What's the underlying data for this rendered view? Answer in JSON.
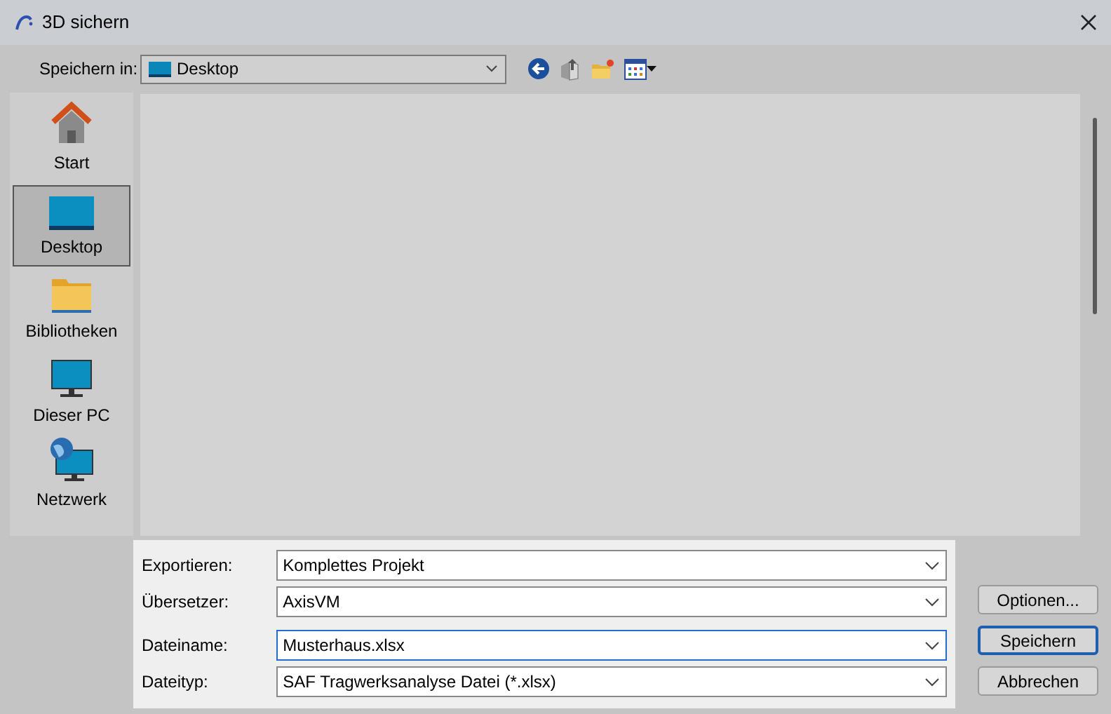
{
  "window": {
    "title": "3D sichern"
  },
  "location": {
    "label": "Speichern in:",
    "value": "Desktop"
  },
  "sidebar": {
    "items": [
      {
        "label": "Start",
        "kind": "home",
        "selected": false
      },
      {
        "label": "Desktop",
        "kind": "desktop",
        "selected": true
      },
      {
        "label": "Bibliotheken",
        "kind": "folder",
        "selected": false
      },
      {
        "label": "Dieser PC",
        "kind": "monitor",
        "selected": false
      },
      {
        "label": "Netzwerk",
        "kind": "network",
        "selected": false
      }
    ]
  },
  "fields": [
    {
      "label": "Exportieren:",
      "value": "Komplettes Projekt",
      "focused": false
    },
    {
      "label": "Übersetzer:",
      "value": "AxisVM",
      "focused": false
    },
    {
      "label": "Dateiname:",
      "value": "Musterhaus.xlsx",
      "focused": true
    },
    {
      "label": "Dateityp:",
      "value": "SAF Tragwerksanalyse Datei (*.xlsx)",
      "focused": false
    }
  ],
  "buttons": [
    {
      "label": "Optionen...",
      "default": false
    },
    {
      "label": "Speichern",
      "default": true
    },
    {
      "label": "Abbrechen",
      "default": false
    }
  ]
}
